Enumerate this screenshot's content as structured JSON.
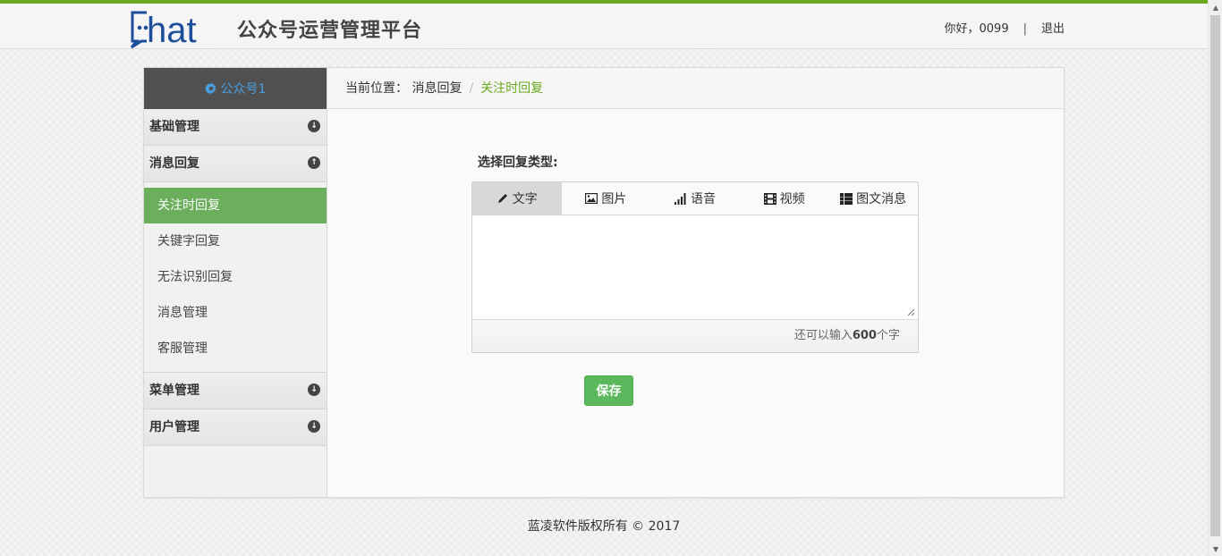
{
  "header": {
    "logo_text": "Chat",
    "title": "公众号运营管理平台",
    "greeting": "你好，0099",
    "separator": "|",
    "logout": "退出"
  },
  "sidebar": {
    "account_name": "公众号1",
    "groups": [
      {
        "label": "基础管理",
        "expanded": false
      },
      {
        "label": "消息回复",
        "expanded": true
      },
      {
        "label": "菜单管理",
        "expanded": false
      },
      {
        "label": "用户管理",
        "expanded": false
      }
    ],
    "message_items": [
      {
        "label": "关注时回复",
        "active": true
      },
      {
        "label": "关键字回复",
        "active": false
      },
      {
        "label": "无法识别回复",
        "active": false
      },
      {
        "label": "消息管理",
        "active": false
      },
      {
        "label": "客服管理",
        "active": false
      }
    ]
  },
  "breadcrumb": {
    "prefix": "当前位置：",
    "parent": "消息回复",
    "separator": "/",
    "current": "关注时回复"
  },
  "reply": {
    "label": "选择回复类型:",
    "tabs": [
      {
        "label": "文字",
        "icon": "pencil-icon",
        "active": true
      },
      {
        "label": "图片",
        "icon": "image-icon",
        "active": false
      },
      {
        "label": "语音",
        "icon": "signal-icon",
        "active": false
      },
      {
        "label": "视频",
        "icon": "film-icon",
        "active": false
      },
      {
        "label": "图文消息",
        "icon": "list-icon",
        "active": false
      }
    ],
    "text_value": "",
    "remaining_prefix": "还可以输入",
    "remaining_count": "600",
    "remaining_suffix": "个字",
    "save_label": "保存"
  },
  "footer": {
    "copyright": "蓝凌软件版权所有 © 2017"
  },
  "colors": {
    "accent": "#6aab1e",
    "active_menu": "#6bae5c",
    "save_button": "#5cb85c",
    "account_link": "#4a9fe0"
  }
}
